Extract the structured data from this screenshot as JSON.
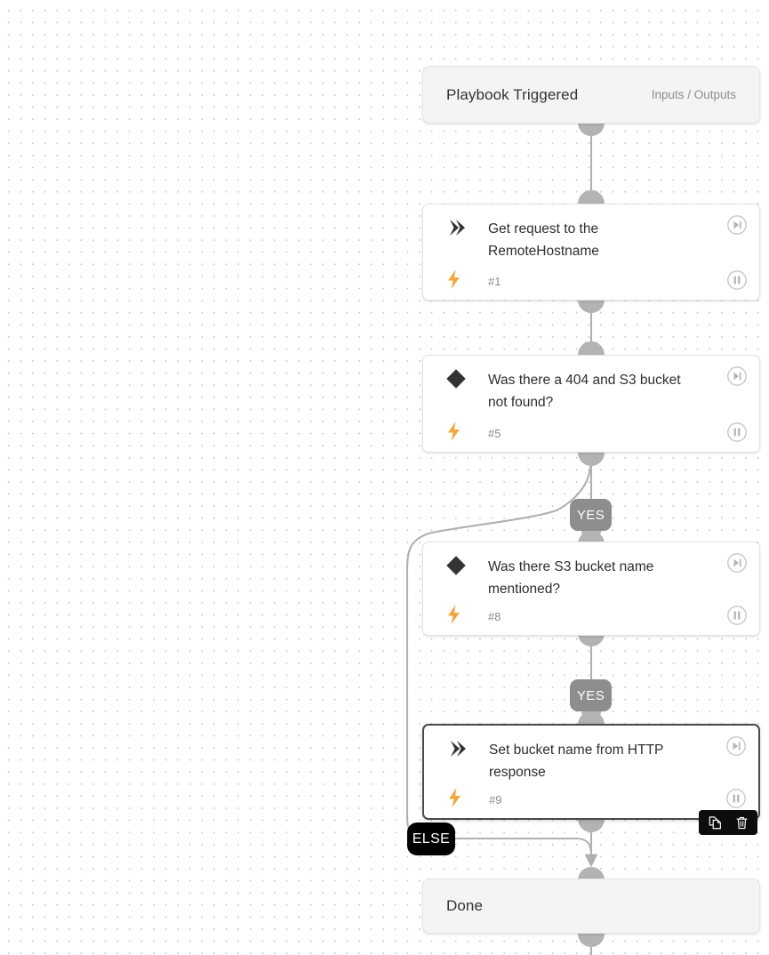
{
  "canvas": {
    "background": "#ffffff",
    "dot_color": "#c9c9c9"
  },
  "colors": {
    "bolt": "#f0a83c",
    "glyph": "#333333",
    "edge": "#b0b0b0",
    "handle": "#b3b3b3",
    "yes_badge_bg": "#8d8d8d",
    "else_badge_bg": "#000000",
    "selected_border": "#4a4a4a",
    "toolbar_bg": "#0d0d0d"
  },
  "start_node": {
    "title": "Playbook Triggered",
    "aux_label": "Inputs / Outputs"
  },
  "end_node": {
    "title": "Done"
  },
  "steps": [
    {
      "title": "Get request to the RemoteHostname",
      "number": "#1",
      "type_icon": "play-chevron-icon",
      "bolt_icon": "lightning-bolt-icon",
      "step_icon": "step-forward-icon",
      "pause_icon": "pause-icon",
      "selected": false
    },
    {
      "title": "Was there a 404 and S3 bucket not found?",
      "number": "#5",
      "type_icon": "decision-diamond-icon",
      "bolt_icon": "lightning-bolt-icon",
      "step_icon": "step-forward-icon",
      "pause_icon": "pause-icon",
      "selected": false
    },
    {
      "title": "Was there S3 bucket name mentioned?",
      "number": "#8",
      "type_icon": "decision-diamond-icon",
      "bolt_icon": "lightning-bolt-icon",
      "step_icon": "step-forward-icon",
      "pause_icon": "pause-icon",
      "selected": false
    },
    {
      "title": "Set bucket name from HTTP response",
      "number": "#9",
      "type_icon": "play-chevron-icon",
      "bolt_icon": "lightning-bolt-icon",
      "step_icon": "step-forward-icon",
      "pause_icon": "pause-icon",
      "selected": true
    }
  ],
  "branch_labels": {
    "yes_1": "YES",
    "yes_2": "YES",
    "else": "ELSE"
  },
  "node_toolbar": {
    "duplicate_icon": "duplicate-icon",
    "delete_icon": "trash-icon"
  }
}
